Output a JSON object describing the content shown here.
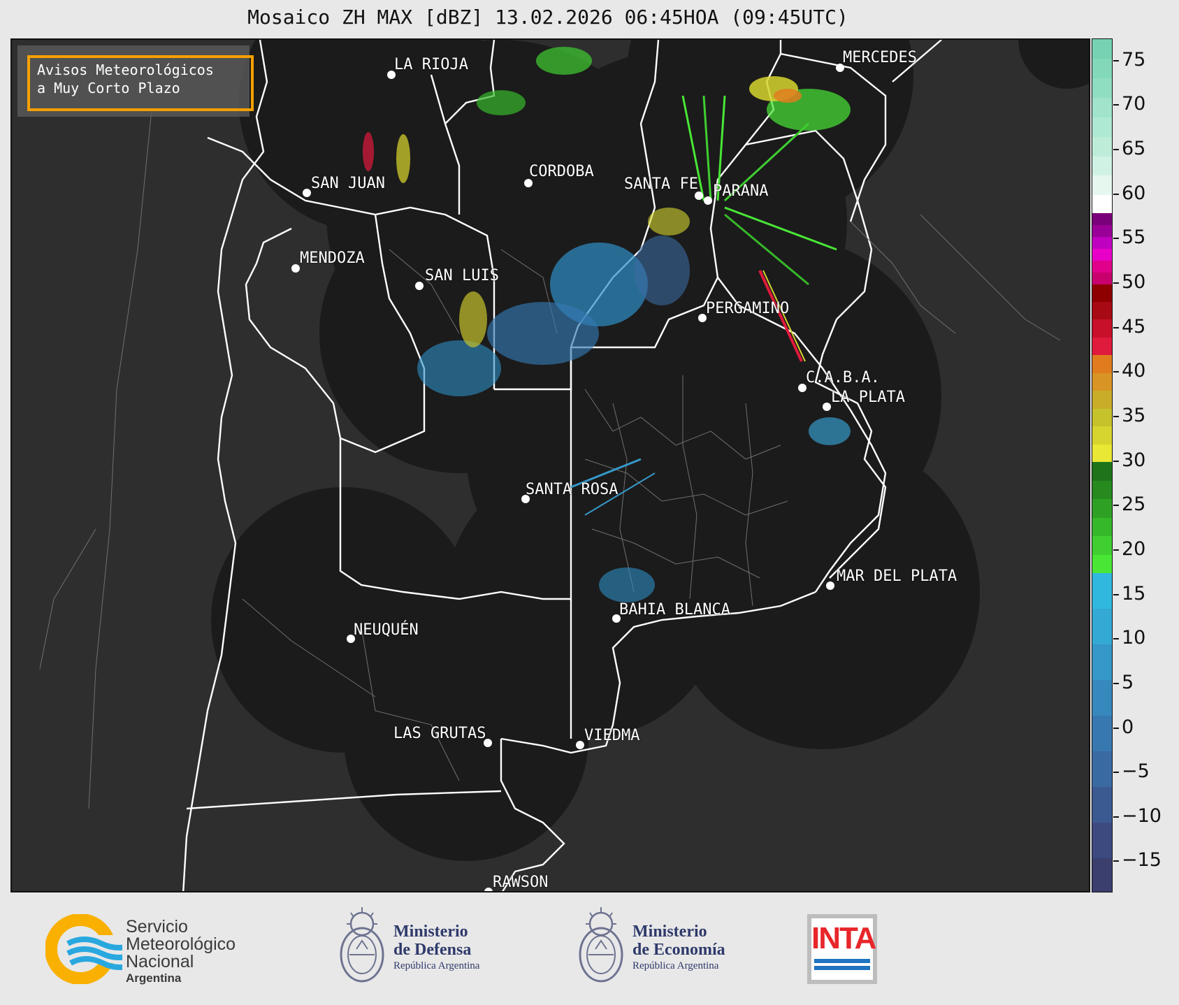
{
  "title": "Mosaico ZH MAX [dBZ] 13.02.2026 06:45HOA (09:45UTC)",
  "warning": {
    "line1": "Avisos Meteorológicos",
    "line2": "a Muy Corto Plazo",
    "border_color": "#f5a000"
  },
  "cities": [
    {
      "name": "LA RIOJA"
    },
    {
      "name": "MERCEDES"
    },
    {
      "name": "SAN JUAN"
    },
    {
      "name": "CORDOBA"
    },
    {
      "name": "SANTA FE"
    },
    {
      "name": "PARANA"
    },
    {
      "name": "MENDOZA"
    },
    {
      "name": "SAN LUIS"
    },
    {
      "name": "PERGAMINO"
    },
    {
      "name": "C.A.B.A."
    },
    {
      "name": "LA PLATA"
    },
    {
      "name": "SANTA ROSA"
    },
    {
      "name": "MAR DEL PLATA"
    },
    {
      "name": "BAHIA BLANCA"
    },
    {
      "name": "NEUQUÉN"
    },
    {
      "name": "LAS GRUTAS"
    },
    {
      "name": "VIEDMA"
    },
    {
      "name": "RAWSON"
    }
  ],
  "colorbar": {
    "unit": "dBZ",
    "ticks": [
      "75",
      "70",
      "65",
      "60",
      "55",
      "50",
      "45",
      "40",
      "35",
      "30",
      "25",
      "20",
      "15",
      "10",
      "5",
      "0",
      "−5",
      "−10",
      "−15"
    ],
    "range": [
      -18.5,
      77.5
    ],
    "bands": [
      {
        "from": -18.5,
        "to": 17.5,
        "colors": [
          "#3a3f6e",
          "#3d4a80",
          "#3c5a92",
          "#3a6aa2",
          "#3878b0",
          "#3688bd",
          "#3598c8",
          "#34a9d4",
          "#30b8de"
        ]
      },
      {
        "from": 17.5,
        "to": 30,
        "colors": [
          "#49e636",
          "#3fcf31",
          "#36b82b",
          "#2ea125",
          "#268a1f",
          "#1f741a"
        ]
      },
      {
        "from": 30,
        "to": 42,
        "colors": [
          "#e8e835",
          "#d6d52f",
          "#c5c22b",
          "#c9ad28",
          "#d89424",
          "#e07c1e"
        ]
      },
      {
        "from": 42,
        "to": 50,
        "colors": [
          "#e01a3c",
          "#c8102a",
          "#a80a14",
          "#8e0000"
        ]
      },
      {
        "from": 50,
        "to": 58,
        "colors": [
          "#c8006e",
          "#e0008a",
          "#e800c8",
          "#c000c0",
          "#9a0098",
          "#7a007a"
        ]
      },
      {
        "from": 58,
        "to": 60,
        "colors": [
          "#ffffff"
        ]
      },
      {
        "from": 60,
        "to": 77.5,
        "colors": [
          "#e6f7ef",
          "#d0f2e4",
          "#bdedd9",
          "#aee9d3",
          "#a0e4cc",
          "#90dec2",
          "#82d8b9",
          "#76d2b2"
        ]
      }
    ]
  },
  "footer": {
    "smn_line1": "Servicio",
    "smn_line2": "Meteorológico",
    "smn_line3": "Nacional",
    "smn_line4": "Argentina",
    "defensa_line1": "Ministerio",
    "defensa_line2": "de Defensa",
    "defensa_line3": "República Argentina",
    "economia_line1": "Ministerio",
    "economia_line2": "de Economía",
    "economia_line3": "República Argentina",
    "inta": "INTA"
  },
  "colors": {
    "smn_orange": "#f9b000",
    "smn_blue": "#29a8df",
    "ministry_blue": "#2f3a6b",
    "inta_red": "#e8262a",
    "inta_blue": "#1f74c0"
  }
}
